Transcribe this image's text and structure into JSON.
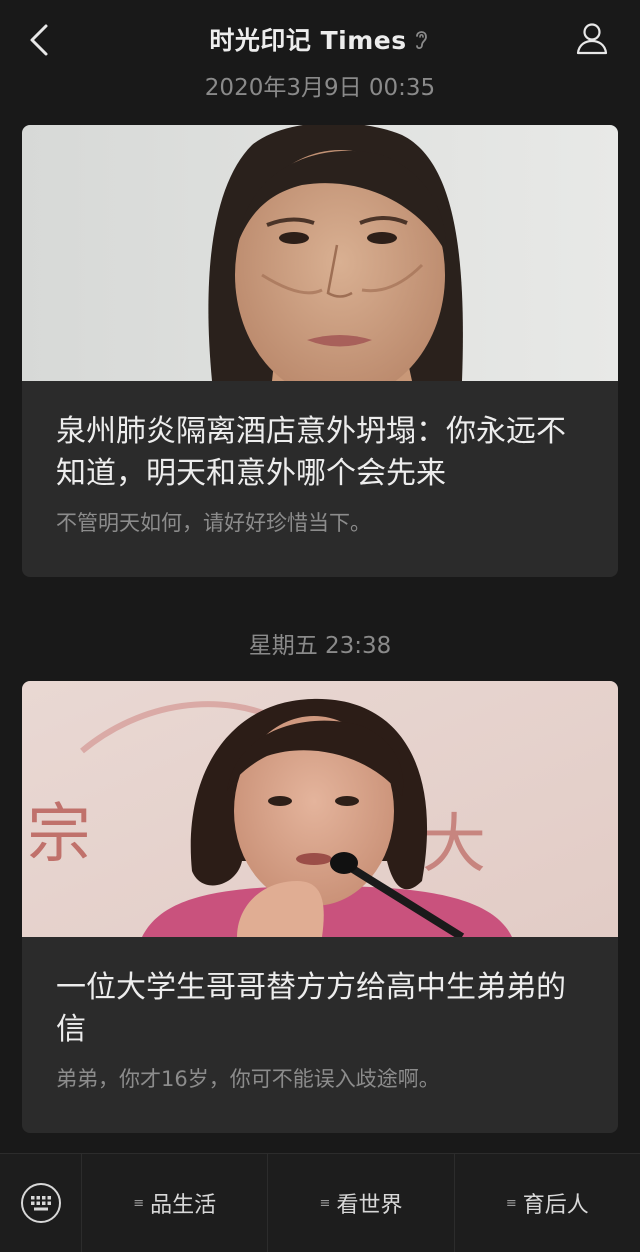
{
  "header": {
    "title": "时光印记 Times"
  },
  "feed": [
    {
      "timestamp": "2020年3月9日 00:35",
      "image_alt": "young woman face portrait",
      "title": "泉州肺炎隔离酒店意外坍塌：你永远不知道，明天和意外哪个会先来",
      "desc": "不管明天如何，请好好珍惜当下。"
    },
    {
      "timestamp": "星期五 23:38",
      "image_alt": "woman speaking into microphone",
      "title": "一位大学生哥哥替方方给高中生弟弟的信",
      "desc": "弟弟，你才16岁，你可不能误入歧途啊。"
    }
  ],
  "bottom_menu": {
    "items": [
      {
        "label": "品生活"
      },
      {
        "label": "看世界"
      },
      {
        "label": "育后人"
      }
    ]
  },
  "icons": {
    "back": "chevron-left-icon",
    "profile": "person-icon",
    "listen": "ear-icon",
    "keyboard": "keyboard-icon",
    "menu": "menu-lines-icon"
  },
  "colors": {
    "background": "#191919",
    "card": "#2b2b2b",
    "text_primary": "#ededed",
    "text_secondary": "#8c8c8c"
  }
}
